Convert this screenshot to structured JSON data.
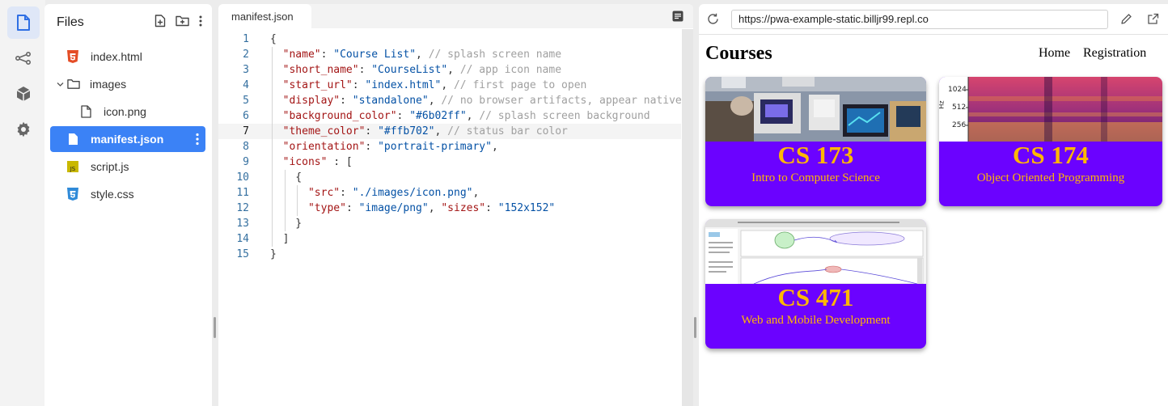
{
  "files_panel": {
    "title": "Files",
    "items": [
      {
        "label": "index.html",
        "icon": "html5-icon"
      },
      {
        "label": "images",
        "icon": "folder-icon"
      },
      {
        "label": "icon.png",
        "icon": "file-icon"
      },
      {
        "label": "manifest.json",
        "icon": "file-icon",
        "selected": true
      },
      {
        "label": "script.js",
        "icon": "js-icon"
      },
      {
        "label": "style.css",
        "icon": "css3-icon"
      }
    ]
  },
  "editor": {
    "tab_label": "manifest.json",
    "line_numbers": [
      "1",
      "2",
      "3",
      "4",
      "5",
      "6",
      "7",
      "8",
      "9",
      "10",
      "11",
      "12",
      "13",
      "14",
      "15"
    ],
    "lines": [
      [
        {
          "t": "{",
          "c": "p"
        }
      ],
      [
        {
          "t": "  ",
          "c": "p"
        },
        {
          "t": "\"name\"",
          "c": "k"
        },
        {
          "t": ": ",
          "c": "p"
        },
        {
          "t": "\"Course List\"",
          "c": "s"
        },
        {
          "t": ", ",
          "c": "p"
        },
        {
          "t": "// splash screen name",
          "c": "c"
        }
      ],
      [
        {
          "t": "  ",
          "c": "p"
        },
        {
          "t": "\"short_name\"",
          "c": "k"
        },
        {
          "t": ": ",
          "c": "p"
        },
        {
          "t": "\"CourseList\"",
          "c": "s"
        },
        {
          "t": ", ",
          "c": "p"
        },
        {
          "t": "// app icon name",
          "c": "c"
        }
      ],
      [
        {
          "t": "  ",
          "c": "p"
        },
        {
          "t": "\"start_url\"",
          "c": "k"
        },
        {
          "t": ": ",
          "c": "p"
        },
        {
          "t": "\"index.html\"",
          "c": "s"
        },
        {
          "t": ", ",
          "c": "p"
        },
        {
          "t": "// first page to open",
          "c": "c"
        }
      ],
      [
        {
          "t": "  ",
          "c": "p"
        },
        {
          "t": "\"display\"",
          "c": "k"
        },
        {
          "t": ": ",
          "c": "p"
        },
        {
          "t": "\"standalone\"",
          "c": "s"
        },
        {
          "t": ", ",
          "c": "p"
        },
        {
          "t": "// no browser artifacts, appear native",
          "c": "c"
        }
      ],
      [
        {
          "t": "  ",
          "c": "p"
        },
        {
          "t": "\"background_color\"",
          "c": "k"
        },
        {
          "t": ": ",
          "c": "p"
        },
        {
          "t": "\"#6b02ff\"",
          "c": "s"
        },
        {
          "t": ", ",
          "c": "p"
        },
        {
          "t": "// splash screen background",
          "c": "c"
        }
      ],
      [
        {
          "t": "  ",
          "c": "p"
        },
        {
          "t": "\"theme_color\"",
          "c": "k"
        },
        {
          "t": ": ",
          "c": "p"
        },
        {
          "t": "\"#ffb702\"",
          "c": "s"
        },
        {
          "t": ", ",
          "c": "p"
        },
        {
          "t": "// status bar color",
          "c": "c"
        }
      ],
      [
        {
          "t": "  ",
          "c": "p"
        },
        {
          "t": "\"orientation\"",
          "c": "k"
        },
        {
          "t": ": ",
          "c": "p"
        },
        {
          "t": "\"portrait-primary\"",
          "c": "s"
        },
        {
          "t": ",",
          "c": "p"
        }
      ],
      [
        {
          "t": "  ",
          "c": "p"
        },
        {
          "t": "\"icons\"",
          "c": "k"
        },
        {
          "t": " : [",
          "c": "p"
        }
      ],
      [
        {
          "t": "    {",
          "c": "p"
        }
      ],
      [
        {
          "t": "      ",
          "c": "p"
        },
        {
          "t": "\"src\"",
          "c": "k"
        },
        {
          "t": ": ",
          "c": "p"
        },
        {
          "t": "\"./images/icon.png\"",
          "c": "s"
        },
        {
          "t": ",",
          "c": "p"
        }
      ],
      [
        {
          "t": "      ",
          "c": "p"
        },
        {
          "t": "\"type\"",
          "c": "k"
        },
        {
          "t": ": ",
          "c": "p"
        },
        {
          "t": "\"image/png\"",
          "c": "s"
        },
        {
          "t": ", ",
          "c": "p"
        },
        {
          "t": "\"sizes\"",
          "c": "k"
        },
        {
          "t": ": ",
          "c": "p"
        },
        {
          "t": "\"152x152\"",
          "c": "s"
        }
      ],
      [
        {
          "t": "    }",
          "c": "p"
        }
      ],
      [
        {
          "t": "  ]",
          "c": "p"
        }
      ],
      [
        {
          "t": "}",
          "c": "p"
        }
      ]
    ],
    "current_line": 7
  },
  "preview": {
    "url": "https://pwa-example-static.billjr99.repl.co",
    "site_title": "Courses",
    "nav": [
      "Home",
      "Registration"
    ],
    "cards": [
      {
        "code": "CS 173",
        "name": "Intro to Computer Science"
      },
      {
        "code": "CS 174",
        "name": "Object Oriented Programming",
        "axis_labels": [
          "1024",
          "512",
          "256"
        ],
        "axis_unit": "Hz"
      },
      {
        "code": "CS 471",
        "name": "Web and Mobile Development"
      }
    ]
  },
  "colors": {
    "card_background": "#6b02ff",
    "card_text": "#ffb702",
    "selection_blue": "#3b82f6"
  }
}
